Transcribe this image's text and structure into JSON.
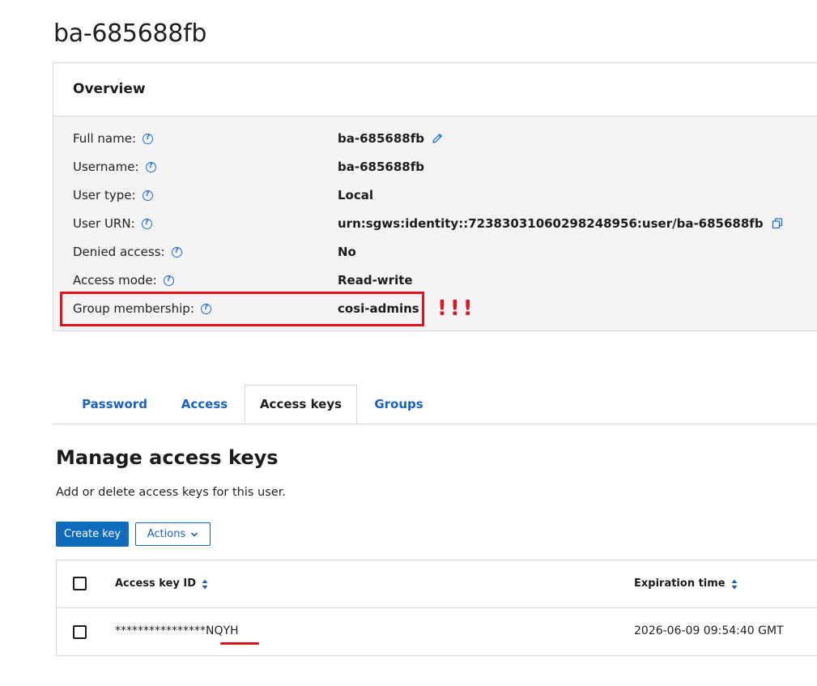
{
  "page": {
    "title": "ba-685688fb"
  },
  "overview": {
    "title": "Overview",
    "rows": [
      {
        "label": "Full name:",
        "value": "ba-685688fb"
      },
      {
        "label": "Username:",
        "value": "ba-685688fb"
      },
      {
        "label": "User type:",
        "value": "Local"
      },
      {
        "label": "User URN:",
        "value": "urn:sgws:identity::72383031060298248956:user/ba-685688fb"
      },
      {
        "label": "Denied access:",
        "value": "No"
      },
      {
        "label": "Access mode:",
        "value": "Read-write"
      },
      {
        "label": "Group membership:",
        "value": "cosi-admins"
      }
    ],
    "annotation_marks": "!!!"
  },
  "tabs": [
    {
      "label": "Password",
      "active": false
    },
    {
      "label": "Access",
      "active": false
    },
    {
      "label": "Access keys",
      "active": true
    },
    {
      "label": "Groups",
      "active": false
    }
  ],
  "access_keys": {
    "heading": "Manage access keys",
    "description": "Add or delete access keys for this user.",
    "create_button": "Create key",
    "actions_button": "Actions",
    "table": {
      "columns": [
        "Access key ID",
        "Expiration time"
      ],
      "rows": [
        {
          "key_id": "****************NQYH",
          "expiration": "2026-06-09 09:54:40 GMT"
        }
      ]
    }
  },
  "colors": {
    "link": "#1a62c0",
    "primary_button": "#0f6cbd",
    "highlight": "#e0141e"
  }
}
